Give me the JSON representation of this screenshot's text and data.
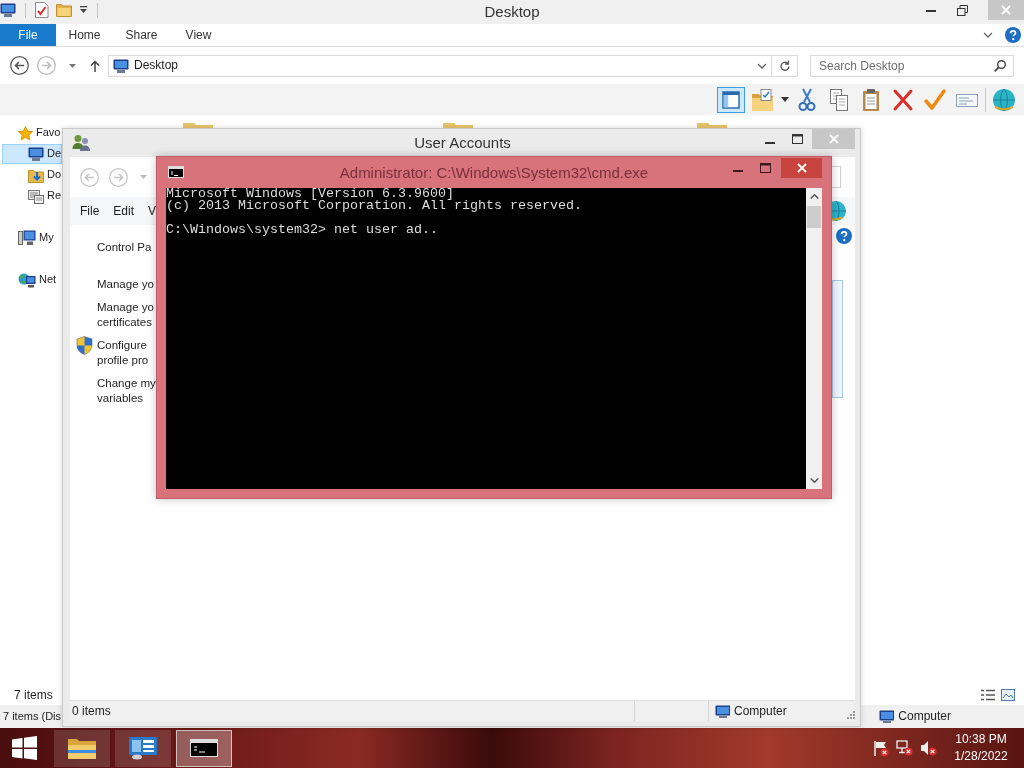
{
  "explorer": {
    "title": "Desktop",
    "ribbon": {
      "file_tab": "File",
      "tabs": [
        "Home",
        "Share",
        "View"
      ]
    },
    "address": {
      "value": "Desktop"
    },
    "search": {
      "placeholder": "Search Desktop"
    },
    "toolbar": [
      {
        "selected": true,
        "has_menu": false
      },
      {
        "selected": false,
        "has_menu": true
      },
      {
        "selected": false,
        "has_menu": false
      },
      {
        "selected": false,
        "has_menu": false
      },
      {
        "selected": false,
        "has_menu": false
      },
      {
        "selected": false,
        "has_menu": false
      },
      {
        "selected": false,
        "has_menu": false
      },
      {
        "selected": false,
        "has_menu": false
      },
      {
        "selected": false,
        "has_menu": false
      }
    ],
    "nav_pane": [
      {
        "label": "Favo",
        "selected": false,
        "children": [
          {
            "label": "De",
            "selected": true
          },
          {
            "label": "Do",
            "selected": false
          },
          {
            "label": "Re",
            "selected": false
          }
        ]
      },
      {
        "label": "My",
        "selected": false
      },
      {
        "label": "Net",
        "selected": false
      }
    ],
    "status": "7 items",
    "status_2": "7 items (Dis",
    "status_location": "Computer"
  },
  "user_accounts": {
    "title": "User Accounts",
    "menu": [
      "File",
      "Edit",
      "V"
    ],
    "tasks": [
      {
        "kind": "home",
        "shield": false,
        "lines": [
          "Control Pa"
        ]
      },
      {
        "kind": "task",
        "shield": false,
        "lines": [
          "Manage yo"
        ]
      },
      {
        "kind": "task",
        "shield": false,
        "lines": [
          "Manage yo",
          "certificates"
        ]
      },
      {
        "kind": "task",
        "shield": true,
        "lines": [
          "Configure",
          "profile pro"
        ]
      },
      {
        "kind": "task",
        "shield": false,
        "lines": [
          "Change my",
          "variables"
        ]
      }
    ],
    "status": "0 items",
    "status_location": "Computer"
  },
  "cmd": {
    "title": "Administrator: C:\\Windows\\System32\\cmd.exe",
    "output": [
      "Microsoft Windows [Version 6.3.9600]",
      "(c) 2013 Microsoft Corporation. All rights reserved."
    ],
    "prompt": "C:\\Windows\\system32> net user ad.."
  },
  "taskbar": {
    "apps": [
      {
        "active": false
      },
      {
        "active": false
      },
      {
        "active": true
      }
    ],
    "time": "10:38 PM",
    "date": "1/28/2022"
  }
}
